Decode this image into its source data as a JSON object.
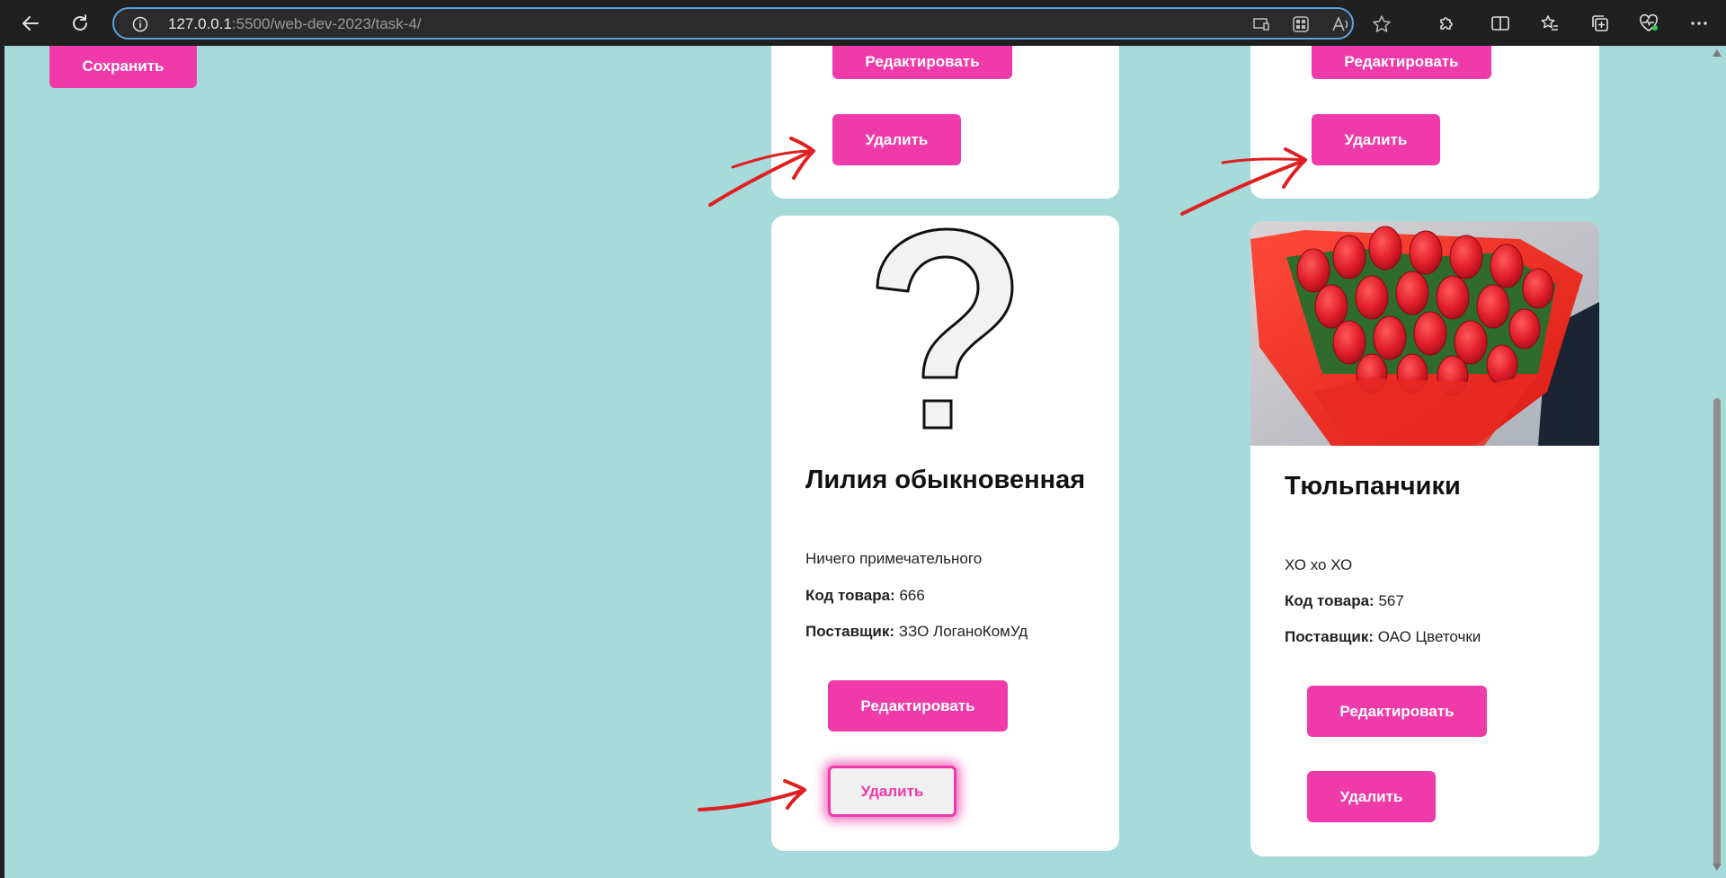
{
  "browser": {
    "url_host": "127.0.0.1",
    "url_rest": ":5500/web-dev-2023/task-4/"
  },
  "page": {
    "save_label": "Сохранить",
    "cards_top": [
      {
        "edit_label": "Редактировать",
        "delete_label": "Удалить"
      },
      {
        "edit_label": "Редактировать",
        "delete_label": "Удалить"
      }
    ],
    "cards": [
      {
        "title": "Лилия обыкновенная",
        "description": "Ничего примечательного",
        "code_label": "Код товара:",
        "code_value": "666",
        "supplier_label": "Поставщик:",
        "supplier_value": "ЗЗО ЛоганоКомУд",
        "edit_label": "Редактировать",
        "delete_label": "Удалить"
      },
      {
        "title": "Тюльпанчики",
        "description": "ХО хо ХО",
        "code_label": "Код товара:",
        "code_value": "567",
        "supplier_label": "Поставщик:",
        "supplier_value": "ОАО Цветочки",
        "edit_label": "Редактировать",
        "delete_label": "Удалить"
      }
    ]
  },
  "colors": {
    "page_bg": "#a6dadb",
    "accent": "#ef3aa9",
    "annotation_red": "#e02020"
  }
}
